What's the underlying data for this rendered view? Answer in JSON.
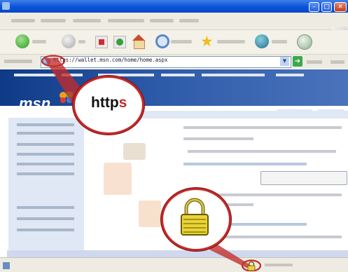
{
  "browser": {
    "address_url": "https://wallet.msn.com/home/home.aspx"
  },
  "page": {
    "logo_text": "msn"
  },
  "callouts": {
    "protocol_prefix": "http",
    "protocol_suffix": "s",
    "lock_icon": "padlock-icon"
  },
  "colors": {
    "titlebar": "#0a53d8",
    "callout_red": "#c32a2a",
    "msn_header": "#2d5aa8"
  }
}
